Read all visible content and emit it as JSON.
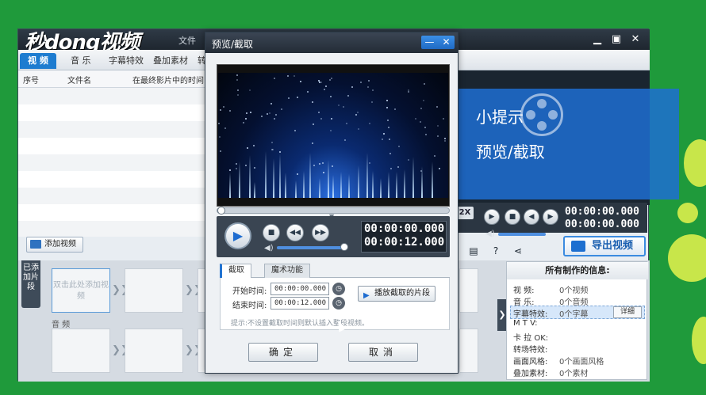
{
  "app": {
    "logo": "秒dong视频",
    "menu_file": "文件",
    "tabs": [
      "视 频",
      "音 乐",
      "字幕特效",
      "叠加素材",
      "转"
    ],
    "list_columns": [
      "序号",
      "文件名",
      "在最终影片中的时间"
    ],
    "add_video_label": "添加视频",
    "timeline_label": "已添加片段",
    "first_clip_text": "双击此处添加视频",
    "audio_track_label": "音 频",
    "speed_label": "2X",
    "right_time_current": "00:00:00.000",
    "right_time_total": "00:00:00.000",
    "export_label": "导出视频",
    "hint_line1": "小提示",
    "hint_line2": "预览/截取"
  },
  "info_panel": {
    "title": "所有制作的信息:",
    "rows": [
      {
        "label": "视    频:",
        "value": "0个视频"
      },
      {
        "label": "音    乐:",
        "value": "0个音频"
      },
      {
        "label": "字幕特效:",
        "value": "0个字幕"
      },
      {
        "label": "M  T  V:",
        "value": ""
      },
      {
        "label": "卡 拉 OK:",
        "value": ""
      },
      {
        "label": "转场特效:",
        "value": ""
      },
      {
        "label": "画面风格:",
        "value": "0个画面风格"
      },
      {
        "label": "叠加素材:",
        "value": "0个素材"
      }
    ],
    "detail_label": "详细"
  },
  "dialog": {
    "title": "预览/截取",
    "time_current": "00:00:00.000",
    "time_total": "00:00:12.000",
    "subtabs": [
      "截取",
      "魔术功能"
    ],
    "start_label": "开始时间:",
    "start_value": "00:00:00.000",
    "end_label": "结束时间:",
    "end_value": "00:00:12.000",
    "play_clip_label": "播放截取的片段",
    "hint": "提示:不设置截取时间则默认插入整段视频。",
    "confirm_label": "确定",
    "cancel_label": "取消"
  },
  "colors": {
    "background": "#1f9a3b",
    "accent": "#1e7cd0",
    "hint_overlay": "#1e6ed2"
  },
  "icons": [
    "play-icon",
    "stop-icon",
    "prev-icon",
    "next-icon",
    "volume-icon",
    "clock-icon",
    "minimize-icon",
    "close-icon",
    "export-icon",
    "save-icon",
    "share-icon"
  ]
}
